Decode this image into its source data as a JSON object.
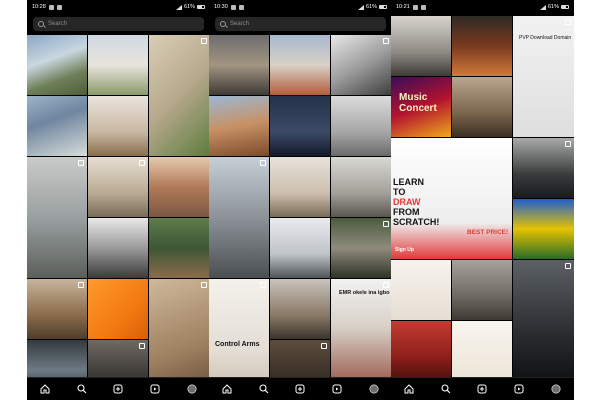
{
  "phones": [
    {
      "time": "10:28",
      "battery": "61%",
      "search_placeholder": "Search",
      "tiles": [
        {
          "name": "house-exterior-tile",
          "bg": "linear-gradient(160deg,#8aa7c4 0%,#c9d7e0 40%,#6e7f58 70%,#4f5c3b 100%)"
        },
        {
          "name": "villa-tile",
          "bg": "linear-gradient(180deg,#cfd8e2 0%,#e8e4dc 50%,#8c9a6c 100%)"
        },
        {
          "name": "bike-tile",
          "bg": "linear-gradient(135deg,#d9ceb6 0%,#b6a88c 50%,#5c7c3c 100%)",
          "tall": true
        },
        {
          "name": "tower-tile",
          "bg": "linear-gradient(160deg,#9db4c8 0%,#6f86a0 40%,#d7ddd8 100%)"
        },
        {
          "name": "vases-tile",
          "bg": "linear-gradient(180deg,#e9e4dd 0%,#c8b8a2 60%,#8a6c4c 100%)"
        },
        {
          "name": "street-car-tile",
          "bg": "linear-gradient(180deg,#c8cbc8 0%,#9aa0a0 50%,#5a5f5a 100%)",
          "tall": true
        },
        {
          "name": "bedroom-tile",
          "bg": "linear-gradient(180deg,#e7dfd2 0%,#b9ab94 60%,#7a6b58 100%)"
        },
        {
          "name": "resort-tile",
          "bg": "linear-gradient(180deg,#e5c9ad 0%,#b17a58 50%,#7b5741 100%)"
        },
        {
          "name": "jerseys-tile",
          "bg": "linear-gradient(180deg,#e9e9e9 0%,#9a9a9a 50%,#3b3b3b 100%)"
        },
        {
          "name": "garden-house-tile",
          "bg": "linear-gradient(180deg,#5e7d4c 0%,#3d5634 50%,#8c6b4c 100%)"
        },
        {
          "name": "cantilever-house-tile",
          "bg": "linear-gradient(180deg,#c7b59c 0%,#8b6b4a 60%,#4e3d2c 100%)"
        },
        {
          "name": "orange-brick-tile",
          "bg": "linear-gradient(135deg,#ff9a2e 0%,#f37a12 60%,#d85f06 100%)"
        },
        {
          "name": "worker-tile",
          "bg": "linear-gradient(160deg,#cfb99a 0%,#9c7f5f 60%,#5e4733 100%)",
          "tall": true
        },
        {
          "name": "glass-house-tile",
          "bg": "linear-gradient(180deg,#34393e 0%,#6d7a83 50%,#20252a 100%)"
        },
        {
          "name": "night-interior-tile",
          "bg": "linear-gradient(180deg,#6f6a63 0%,#3b3733 60%,#1c1a18 100%)"
        }
      ]
    },
    {
      "time": "10:30",
      "battery": "61%",
      "search_placeholder": "Search",
      "tiles": [
        {
          "name": "modern-block-house-tile",
          "bg": "linear-gradient(180deg,#6d6d6d 0%,#a29582 50%,#3e3a36 100%)"
        },
        {
          "name": "skyscraper-tile",
          "bg": "linear-gradient(180deg,#a8b9cd 0%,#d8d1c7 50%,#b45c3a 100%)"
        },
        {
          "name": "car-interior-tile",
          "bg": "linear-gradient(150deg,#e8e8e8 0%,#9d9d9d 50%,#3d3d3d 100%)"
        },
        {
          "name": "timber-facade-tile",
          "bg": "linear-gradient(170deg,#9cb8d4 0%,#c89064 50%,#7a4a2a 100%)"
        },
        {
          "name": "lit-wall-tile",
          "bg": "linear-gradient(180deg,#23314a 0%,#3c4a66 60%,#12192a 100%)"
        },
        {
          "name": "grey-interior-tile",
          "bg": "linear-gradient(180deg,#dcdcdc 0%,#a6a6a6 60%,#6a6a6a 100%)"
        },
        {
          "name": "buggy-tile",
          "bg": "linear-gradient(180deg,#c6cfd7 0%,#8c9298 50%,#4b4f52 100%)",
          "tall": true
        },
        {
          "name": "spiral-stair-tile",
          "bg": "linear-gradient(180deg,#e6e2dc 0%,#cdbfae 60%,#7b6b58 100%)"
        },
        {
          "name": "curve-sculpture-tile",
          "bg": "linear-gradient(180deg,#d8d8d4 0%,#a3a099 60%,#595650 100%)"
        },
        {
          "name": "white-villa-tile",
          "bg": "linear-gradient(180deg,#e9ebee 0%,#bfc4ca 60%,#4f5458 100%)"
        },
        {
          "name": "terrace-house-tile",
          "bg": "linear-gradient(180deg,#4b5b3d 0%,#8f8a7c 50%,#2d3326 100%)"
        },
        {
          "name": "hand-sketch-tile",
          "bg": "linear-gradient(180deg,#f4f1ec 0%,#e3ddd4 60%,#c5b9a8 100%)",
          "tall": true
        },
        {
          "name": "modern-stone-house-tile",
          "bg": "linear-gradient(180deg,#c8c3bc 0%,#8a7a66 60%,#3a342c 100%)"
        },
        {
          "name": "igbo-vendor-tile",
          "bg": "linear-gradient(180deg,#f2f2f2 0%,#d7d0c6 40%,#8b3a2e 100%)",
          "tall": true
        },
        {
          "name": "brown-interior-tile",
          "bg": "linear-gradient(180deg,#5d4d3e 0%,#3a3026 60%,#1d1813 100%)"
        }
      ],
      "captions": {
        "control_arms": "Control Arms",
        "igbo_text": "EMR okele ina igbo"
      }
    },
    {
      "time": "10:21",
      "battery": "61%",
      "tiles": [
        {
          "name": "kitchen-tile",
          "bg": "linear-gradient(180deg,#d8d4cd 0%,#8e8a84 60%,#3e3b37 100%)"
        },
        {
          "name": "aframe-cabin-tile",
          "bg": "linear-gradient(180deg,#2d2a26 0%,#7a3a1e 50%,#d07a3a 100%)"
        },
        {
          "name": "meme-tile",
          "bg": "linear-gradient(180deg,#f2f2f2 0%,#dedede 100%)",
          "tall": true
        },
        {
          "name": "music-concert-tile",
          "bg": "linear-gradient(160deg,#3a0d5a 0%,#b3122e 50%,#f0a81c 100%)"
        },
        {
          "name": "tv-wall-tile",
          "bg": "linear-gradient(180deg,#b9a690 0%,#7a654d 60%,#3a2f24 100%)"
        },
        {
          "name": "drawing-course-tile",
          "bg": "linear-gradient(180deg,#ffffff 0%,#eeeeee 70%,#e23a3a 100%)",
          "wide": true
        },
        {
          "name": "sports-car-tile",
          "bg": "linear-gradient(180deg,#a8a9a8 0%,#3b3c3d 60%,#1a1b1c 100%)"
        },
        {
          "name": "football-player-tile",
          "bg": "linear-gradient(180deg,#1d5ed1 0%,#e6c200 50%,#2a6b28 100%)"
        },
        {
          "name": "floor-plan-tile",
          "bg": "linear-gradient(180deg,#f7f3ee 0%,#e6ded3 100%)"
        },
        {
          "name": "aerial-house-tile",
          "bg": "linear-gradient(180deg,#a7a39b 0%,#6e6a62 60%,#3e3a33 100%)"
        },
        {
          "name": "supercar-garage-tile",
          "bg": "linear-gradient(180deg,#5c6166 0%,#2b2e31 60%,#0f1011 100%)",
          "tall": true
        },
        {
          "name": "red-model-tile",
          "bg": "linear-gradient(180deg,#c43b32 0%,#8d1f1a 60%,#4a0f0c 100%)"
        },
        {
          "name": "sketch-plan-tile",
          "bg": "linear-gradient(180deg,#f8f5ef 0%,#ece4d6 100%)"
        }
      ],
      "captions": {
        "concert_title": "Music Concert",
        "course_line1": "LEARN",
        "course_line2": "TO",
        "course_line3": "DRAW",
        "course_line4": "FROM",
        "course_line5": "SCRATCH!",
        "best_price": "BEST PRICE!",
        "sign_up": "Sign Up",
        "meme_text": "PVP Download Domain"
      }
    }
  ],
  "tabs": [
    "home-icon",
    "search-icon",
    "create-icon",
    "reels-icon",
    "profile-icon"
  ]
}
